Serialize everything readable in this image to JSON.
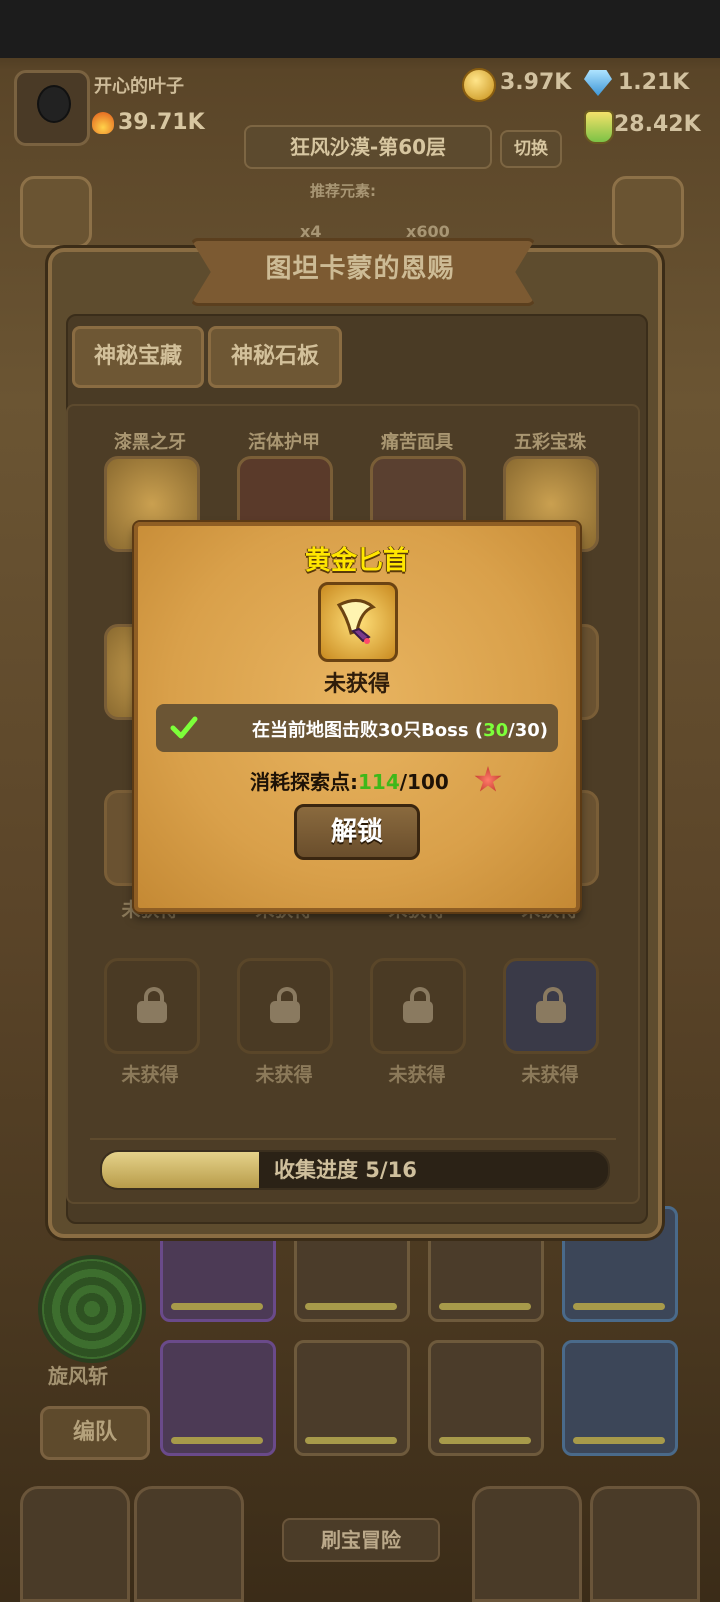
{
  "header": {
    "player_name": "开心的叶子",
    "power": "39.71K",
    "gold": "3.97K",
    "gems": "1.21K",
    "potion": "28.42K",
    "stage": "狂风沙漠-第60层",
    "switch_label": "切换",
    "recommend_label": "推荐元素:",
    "enemy_count_1": "x4",
    "enemy_count_2": "x600"
  },
  "panel": {
    "title": "图坦卡蒙的恩赐",
    "tabs": [
      {
        "label": "神秘宝藏"
      },
      {
        "label": "神秘石板"
      }
    ],
    "row1": [
      {
        "name": "漆黑之牙",
        "icon": "crystal-shard-icon"
      },
      {
        "name": "活体护甲",
        "icon": "armor-icon"
      },
      {
        "name": "痛苦面具",
        "icon": "horned-mask-icon"
      },
      {
        "name": "五彩宝珠",
        "icon": "orb-icon"
      }
    ],
    "row3_status": [
      "未获得",
      "未获得",
      "未获得",
      "未获得"
    ],
    "row4_status": [
      "未获得",
      "未获得",
      "未获得",
      "未获得"
    ],
    "progress": {
      "label": "收集进度 5/16",
      "collected": 5,
      "total": 16
    }
  },
  "popup": {
    "title": "黄金匕首",
    "item_icon": "golden-dagger-icon",
    "status": "未获得",
    "condition_prefix": "在当前地图击败30只Boss (",
    "condition_current": "30",
    "condition_suffix": "/30)",
    "cost_label": "消耗探索点:",
    "cost_have": "114",
    "cost_need": "/100",
    "unlock_label": "解锁"
  },
  "bottom": {
    "skill_name": "旋风斩",
    "team_label": "编队",
    "adventure_label": "刷宝冒险"
  },
  "colors": {
    "popup_title": "#ffe600",
    "condition_met": "#7dff3a",
    "cost_have": "#3fb81a"
  }
}
